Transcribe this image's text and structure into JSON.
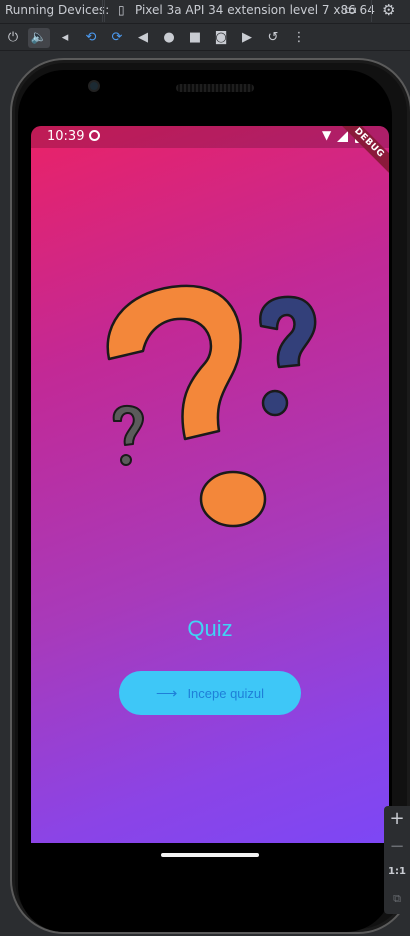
{
  "ide": {
    "panel_title": "Running Devices:",
    "device_tab": "Pixel 3a API 34 extension level 7 x86 64",
    "toolbar_icons": [
      "power-icon",
      "volume-up-icon",
      "volume-down-icon",
      "rotate-left-icon",
      "rotate-right-icon",
      "back-icon",
      "home-icon",
      "overview-icon",
      "screenshot-icon",
      "screen-record-icon",
      "reset-icon",
      "more-icon"
    ]
  },
  "status_bar": {
    "time": "10:39",
    "debug_label": "DEBUG"
  },
  "app": {
    "title": "Quiz",
    "start_button_label": "Incepe quizul",
    "gradient_top": "#ea2267",
    "gradient_bottom": "#7d47f5",
    "accent": "#40d4f5"
  },
  "zoom": {
    "zoom_in": "+",
    "zoom_out": "−",
    "actual_size": "1:1"
  }
}
